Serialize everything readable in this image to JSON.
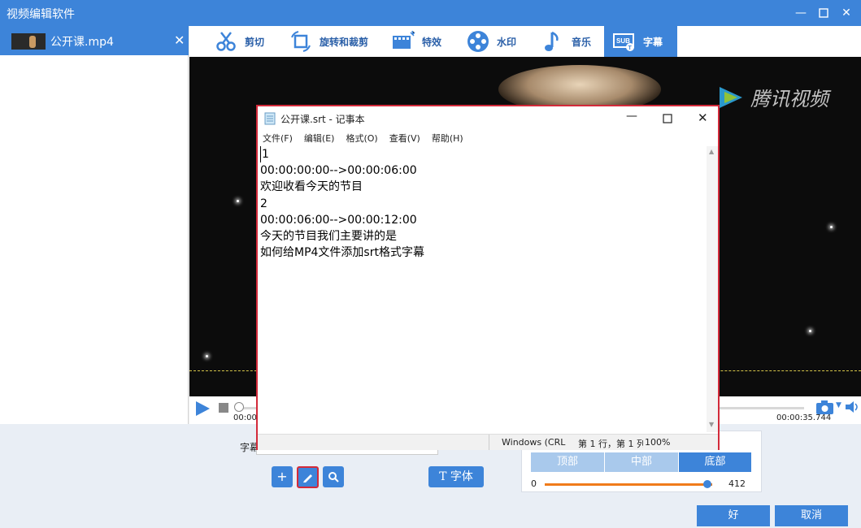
{
  "window": {
    "title": "视频编辑软件",
    "controls": [
      "minimize-icon",
      "maximize-icon",
      "close-icon"
    ]
  },
  "file_list": [
    {
      "name": "公开课.mp4"
    }
  ],
  "toolbar": {
    "items": [
      {
        "label": "剪切",
        "icon": "scissors-icon"
      },
      {
        "label": "旋转和裁剪",
        "icon": "crop-rotate-icon"
      },
      {
        "label": "特效",
        "icon": "film-effect-icon"
      },
      {
        "label": "水印",
        "icon": "film-reel-icon"
      },
      {
        "label": "音乐",
        "icon": "music-note-icon"
      },
      {
        "label": "字幕",
        "icon": "subtitle-icon",
        "active": true
      }
    ]
  },
  "video": {
    "watermark": "腾讯视频",
    "time_start": "00:00",
    "time_end": "00:00:35.744"
  },
  "subtitle_panel": {
    "label_fragment": "字幕",
    "font_button": "字体",
    "position_options": [
      "顶部",
      "中部",
      "底部"
    ],
    "selected_position": "底部",
    "slider_min": "0",
    "slider_value": "412",
    "slider_fraction": 0.97
  },
  "actions": {
    "ok": "好",
    "cancel": "取消"
  },
  "notepad": {
    "title": "公开课.srt - 记事本",
    "menu": [
      "文件(F)",
      "编辑(E)",
      "格式(O)",
      "查看(V)",
      "帮助(H)"
    ],
    "lines": [
      "1",
      "00:00:00:00-->00:00:06:00",
      "欢迎收看今天的节目",
      "2",
      "00:00:06:00-->00:00:12:00",
      "今天的节目我们主要讲的是",
      "如何给MP4文件添加srt格式字幕"
    ],
    "status": {
      "encoding": "Windows (CRL",
      "position": "第 1 行，第 1 列",
      "zoom": "100%"
    }
  },
  "colors": {
    "accent": "#3d84d9",
    "highlight_border": "#d32a3a",
    "slider": "#f07b1a"
  }
}
